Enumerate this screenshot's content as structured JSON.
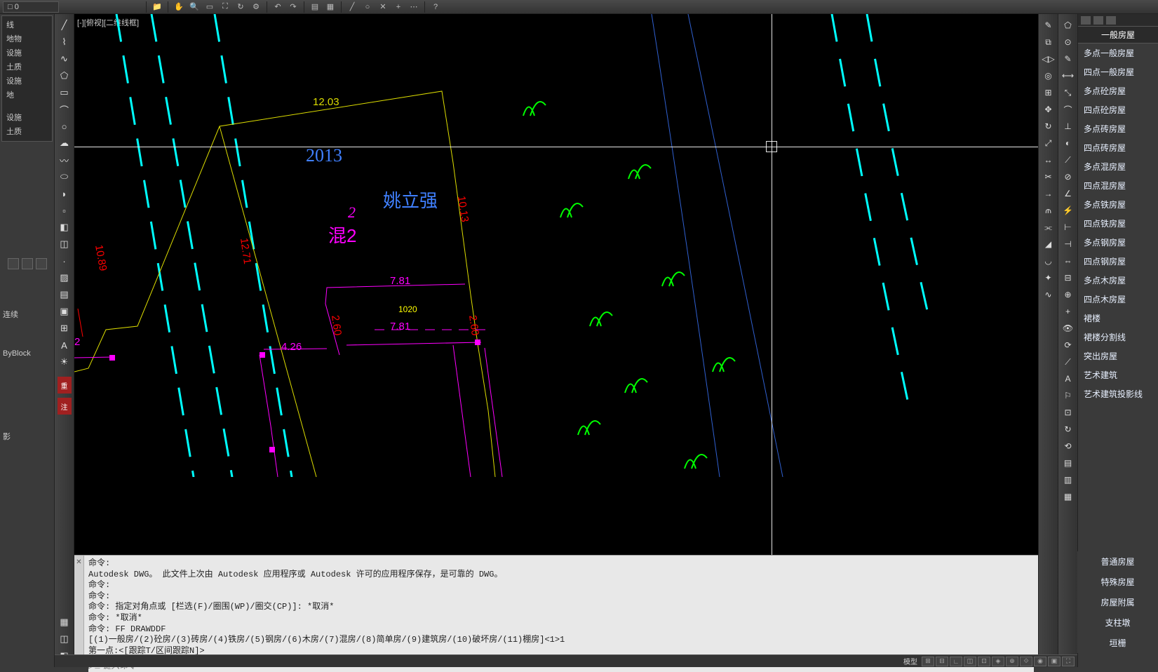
{
  "top": {
    "layer_field": "□ 0"
  },
  "left_panel": {
    "items1": [
      "线",
      "地物",
      "设施",
      "土质",
      "设施",
      "地"
    ],
    "items2": [
      "设施",
      "土质"
    ],
    "labels": {
      "continuous": "连续",
      "byblock": "ByBlock",
      "shadow": "影"
    }
  },
  "canvas": {
    "view_label": "[-][俯视][二维线框]",
    "texts": {
      "year": "2013",
      "name": "姚立强",
      "floor": "2",
      "mix": "混2",
      "yellow_num": "1020"
    },
    "dims": {
      "d1": "12.03",
      "d2": "10.13",
      "d3": "12.71",
      "d4": "10.89",
      "d5": "7.81",
      "d6": "7.81",
      "d7": "4.26",
      "d8": "2.60",
      "d9": "2.60",
      "d10": "2"
    }
  },
  "cmd": {
    "l1": "命令:",
    "l2": "Autodesk DWG。 此文件上次由 Autodesk 应用程序或 Autodesk 许可的应用程序保存，是可靠的 DWG。",
    "l3": "命令:",
    "l4": "命令:",
    "l5": "命令: 指定对角点或 [栏选(F)/圈围(WP)/圈交(CP)]: *取消*",
    "l6": "命令: *取消*",
    "l7": "命令: FF DRAWDDF",
    "l8": "[(1)一般房/(2)砼房/(3)砖房/(4)铁房/(5)钢房/(6)木房/(7)混房/(8)简单房/(9)建筑房/(10)破坏房/(11)棚房]<1>1",
    "l9": "第一点:<[跟踪T/区间跟踪N]>",
    "placeholder": "键入命令"
  },
  "right_menu": {
    "header": "一般房屋",
    "items": [
      "多点一般房屋",
      "四点一般房屋",
      "多点砼房屋",
      "四点砼房屋",
      "多点砖房屋",
      "四点砖房屋",
      "多点混房屋",
      "四点混房屋",
      "多点铁房屋",
      "四点铁房屋",
      "多点钢房屋",
      "四点钢房屋",
      "多点木房屋",
      "四点木房屋",
      "裙楼",
      "裙楼分割线",
      "突出房屋",
      "艺术建筑",
      "艺术建筑投影线"
    ],
    "bottom": [
      "普通房屋",
      "特殊房屋",
      "房屋附属",
      "支柱墩",
      "垣栅"
    ]
  },
  "status": {
    "model": "模型"
  }
}
